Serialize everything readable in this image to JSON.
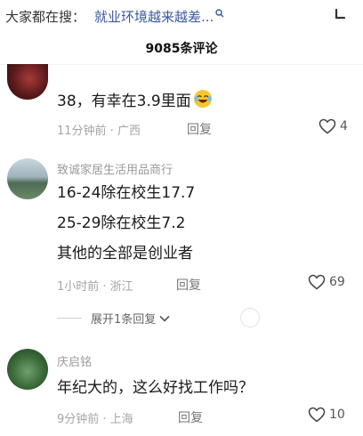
{
  "search": {
    "prefix": "大家都在搜：",
    "query": "就业环境越来越差..."
  },
  "header": {
    "comment_count": "9085条评论"
  },
  "comments": [
    {
      "user": "",
      "lines": [
        "38，有幸在3.9里面"
      ],
      "emoji": "crying-laughing-face",
      "meta": "11分钟前 · 广西",
      "reply_label": "回复",
      "likes": "4"
    },
    {
      "user": "致诚家居生活用品商行",
      "lines": [
        "16-24除在校生17.7",
        "25-29除在校生7.2",
        "其他的全部是创业者"
      ],
      "meta": "1小时前 · 浙江",
      "reply_label": "回复",
      "likes": "69",
      "expand_label": "展开1条回复"
    },
    {
      "user": "庆启铭",
      "lines": [
        "年纪大的，这么好找工作吗？"
      ],
      "meta": "9分钟前 · 上海",
      "reply_label": "回复",
      "likes": "10"
    }
  ],
  "colors": {
    "link": "#3a5a9c",
    "meta": "#a5a5a5",
    "text": "#1a1a1a"
  }
}
